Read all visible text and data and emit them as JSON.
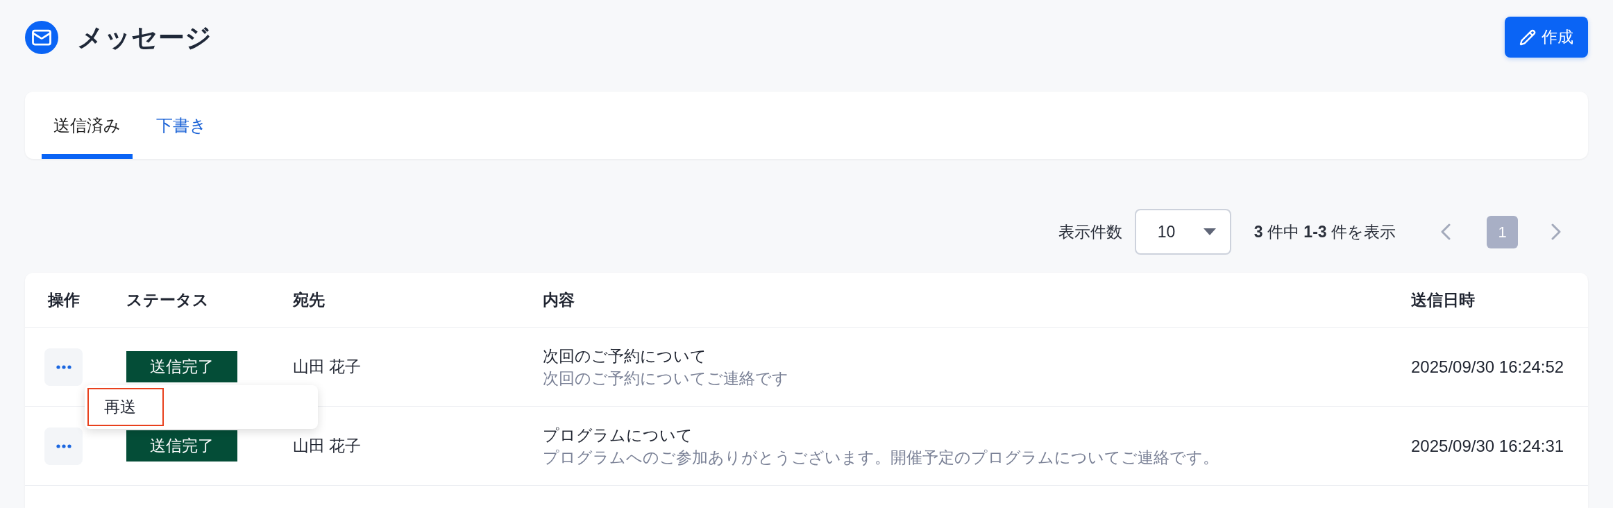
{
  "header": {
    "title": "メッセージ",
    "compose_button": "作成"
  },
  "tabs": [
    {
      "label": "送信済み",
      "selected": true
    },
    {
      "label": "下書き",
      "selected": false
    }
  ],
  "pagination": {
    "page_size_label": "表示件数",
    "page_size": "10",
    "summary": "**3** 件中 **1-3** 件を表示",
    "pages": [
      {
        "label": "1",
        "selected": true
      }
    ]
  },
  "table": {
    "columns": [
      "操作",
      "ステータス",
      "宛先",
      "内容",
      "送信日時"
    ],
    "rows": [
      {
        "status": "送信完了",
        "recipient": "山田 花子",
        "subject": "次回のご予約について",
        "preview": "次回のご予約についてご連絡です",
        "sent_at": "2025/09/30 16:24:52",
        "menu": {
          "items": [
            {
              "label": "再送",
              "highlighted": true
            }
          ]
        }
      },
      {
        "status": "送信完了",
        "recipient": "山田 花子",
        "subject": "プログラムについて",
        "preview": "プログラムへのご参加ありがとうございます。開催予定のプログラムについてご連絡です。",
        "sent_at": "2025/09/30 16:24:31"
      }
    ]
  }
}
